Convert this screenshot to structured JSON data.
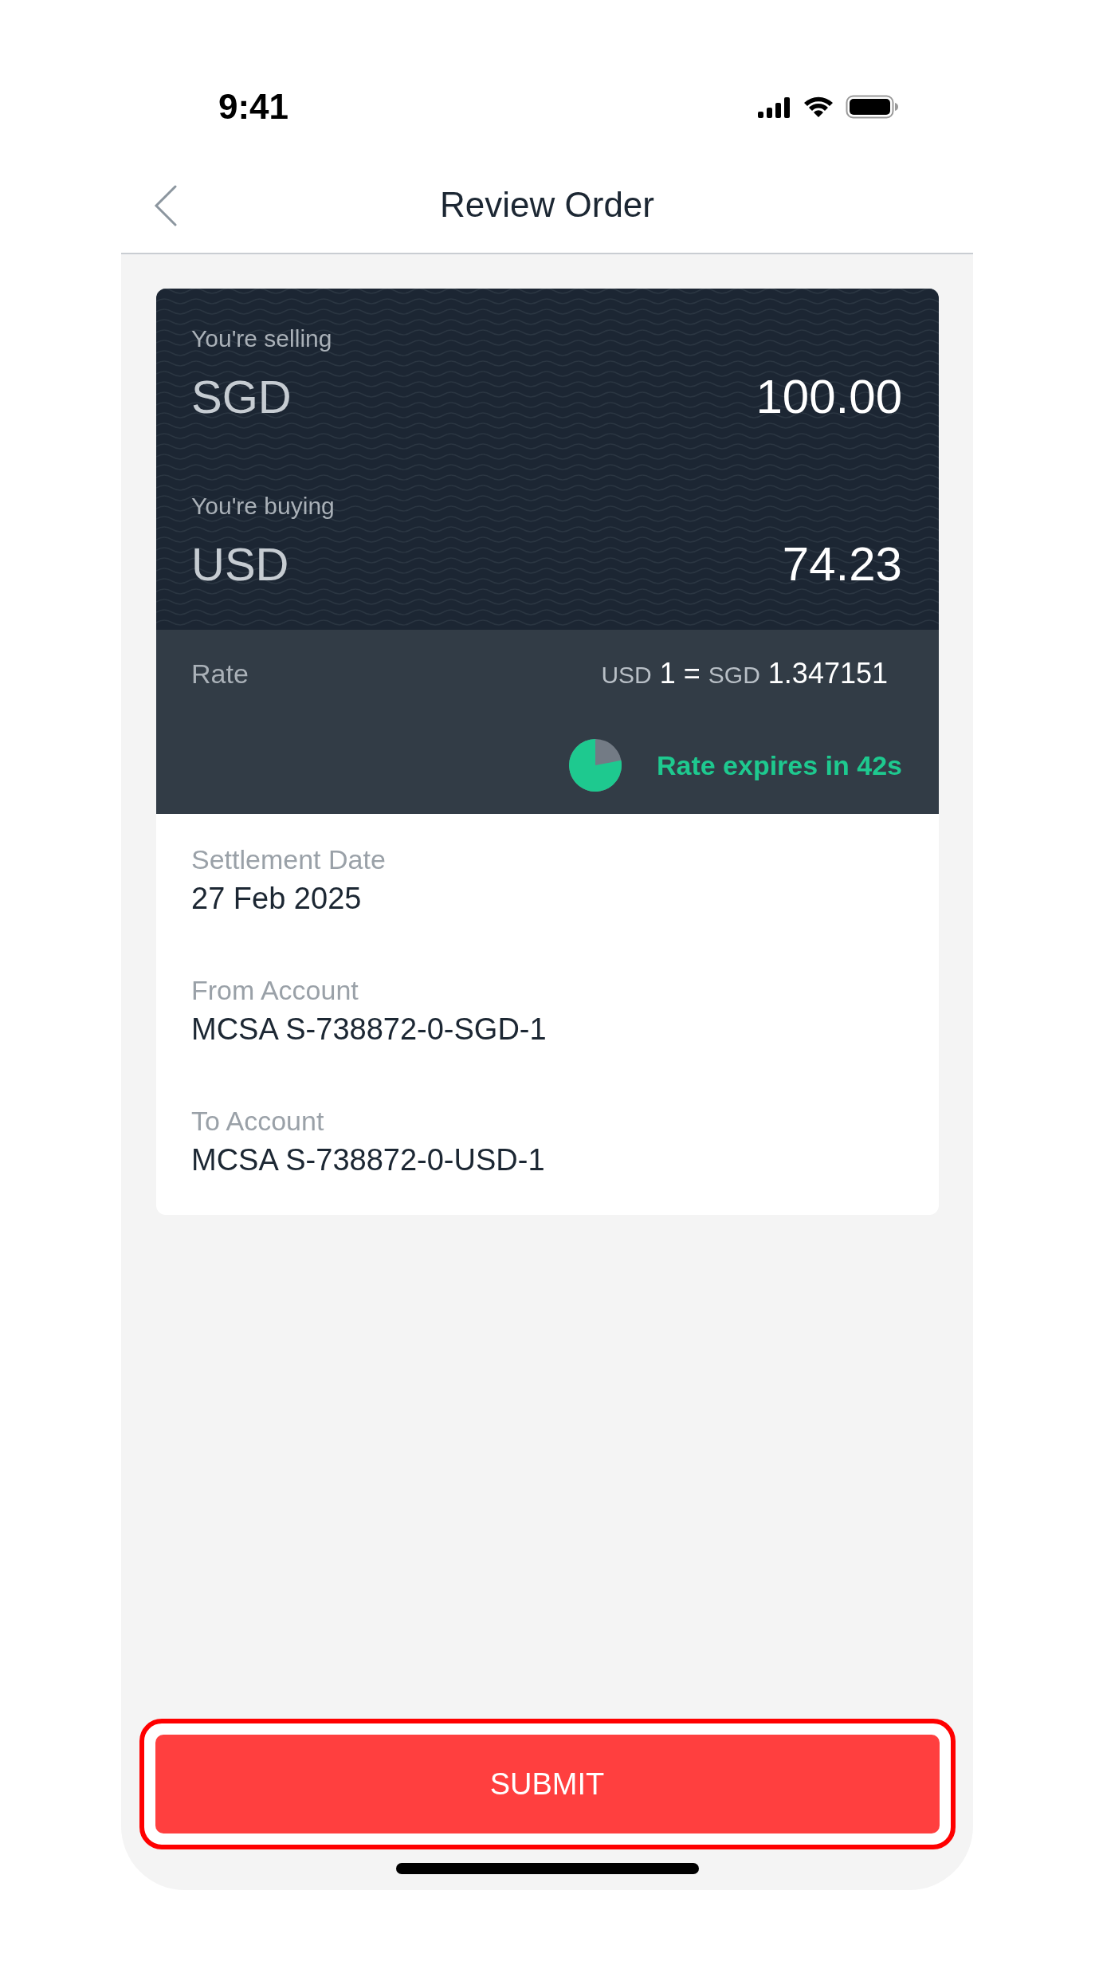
{
  "status_bar": {
    "time": "9:41"
  },
  "nav": {
    "title": "Review Order"
  },
  "exchange": [
    {
      "label": "You're selling",
      "currency": "SGD",
      "amount": "100.00"
    },
    {
      "label": "You're buying",
      "currency": "USD",
      "amount": "74.23"
    }
  ],
  "rate": {
    "label": "Rate",
    "base_currency": "USD",
    "base_amount": "1",
    "equals": "=",
    "quote_currency": "SGD",
    "quote_amount": "1.347151"
  },
  "countdown": {
    "text": "Rate expires in 42s"
  },
  "details": [
    {
      "label": "Settlement Date",
      "value": "27 Feb 2025"
    },
    {
      "label": "From Account",
      "value": "MCSA S-738872-0-SGD-1"
    },
    {
      "label": "To Account",
      "value": "MCSA S-738872-0-USD-1"
    }
  ],
  "submit_button": {
    "label": "SUBMIT",
    "highlighted": true
  }
}
